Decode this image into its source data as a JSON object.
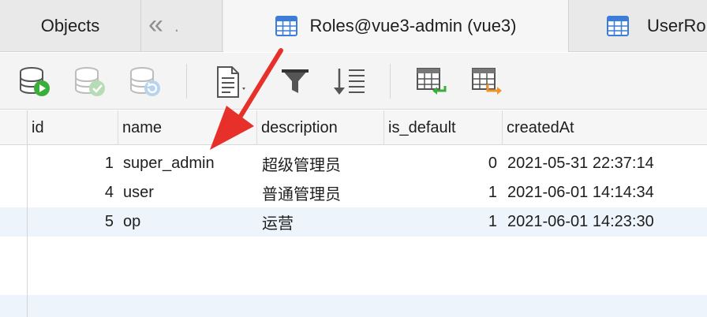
{
  "tabs": {
    "objects_label": "Objects",
    "back_label": "«",
    "back_trailing": ".",
    "active_label": "Roles@vue3-admin (vue3)",
    "next_label": "UserRo"
  },
  "toolbar": {
    "buttons": [
      {
        "icon": "database-run-icon"
      },
      {
        "icon": "database-check-icon"
      },
      {
        "icon": "database-refresh-icon"
      },
      {
        "icon": "document-text-icon"
      },
      {
        "icon": "filter-icon"
      },
      {
        "icon": "sort-icon"
      },
      {
        "icon": "table-import-icon"
      },
      {
        "icon": "table-export-icon"
      }
    ]
  },
  "table": {
    "columns": [
      "id",
      "name",
      "description",
      "is_default",
      "createdAt"
    ],
    "rows": [
      {
        "id": "1",
        "name": "super_admin",
        "description": "超级管理员",
        "is_default": "0",
        "createdAt": "2021-05-31 22:37:14"
      },
      {
        "id": "4",
        "name": "user",
        "description": "普通管理员",
        "is_default": "1",
        "createdAt": "2021-06-01 14:14:34"
      },
      {
        "id": "5",
        "name": "op",
        "description": "运营",
        "is_default": "1",
        "createdAt": "2021-06-01 14:23:30"
      }
    ]
  },
  "colors": {
    "annotation_arrow": "#e8302a",
    "row_alt": "#eef4fb",
    "run_green": "#3aae3a",
    "icon_blue": "#3b7dd8"
  }
}
